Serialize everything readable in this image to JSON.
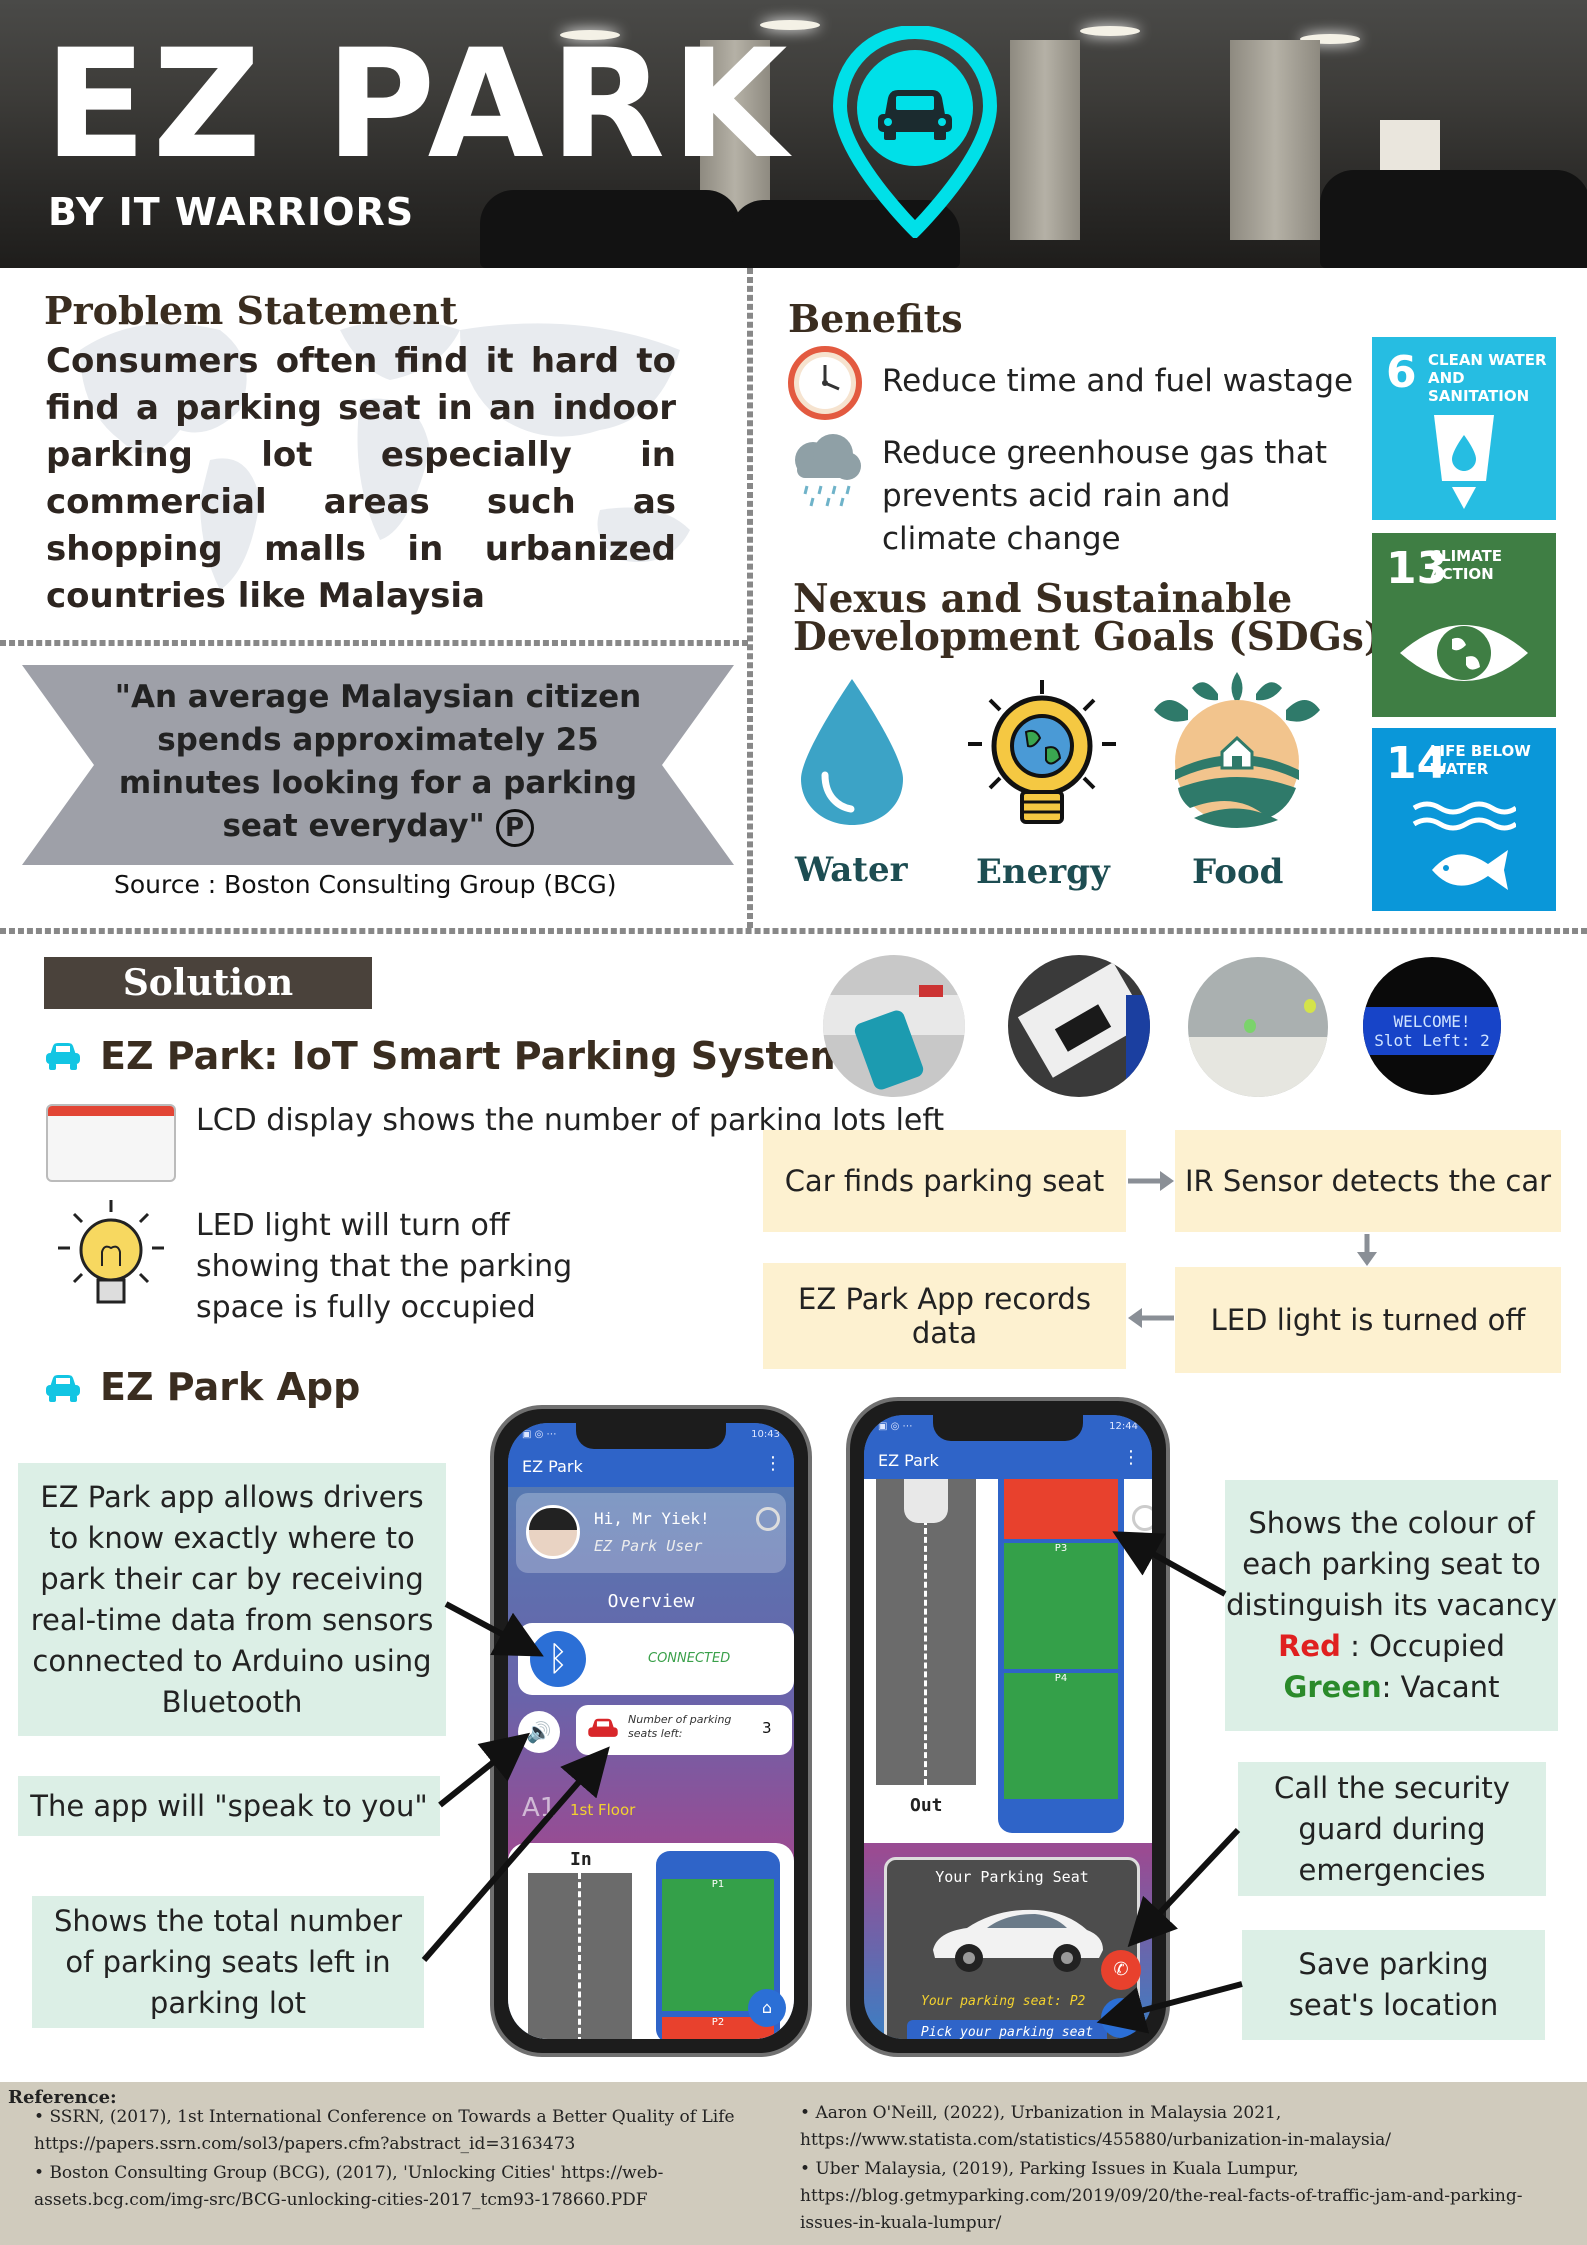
{
  "header": {
    "title": "EZ PARK",
    "subtitle": "BY IT WARRIORS",
    "pin_icon": "car-location-pin-icon",
    "accent": "#00e0e8"
  },
  "problem": {
    "heading": "Problem Statement",
    "text": "Consumers often find it hard to find a parking seat in an indoor parking lot especially in commercial areas such as shopping malls in urbanized countries like Malaysia"
  },
  "quote": {
    "text": "\"An average Malaysian citizen spends approximately 25 minutes looking for a parking seat everyday\"",
    "p_symbol": "P",
    "source": "Source : Boston Consulting Group (BCG)"
  },
  "benefits": {
    "heading": "Benefits",
    "items": [
      {
        "icon": "clock-icon",
        "text": "Reduce time and fuel wastage"
      },
      {
        "icon": "rain-cloud-icon",
        "text": "Reduce greenhouse gas that prevents acid rain and climate change"
      }
    ]
  },
  "nexus": {
    "heading_line1": "Nexus and Sustainable",
    "heading_line2": "Development Goals (SDGs)",
    "items": [
      {
        "icon": "water-drop-icon",
        "label": "Water"
      },
      {
        "icon": "lightbulb-globe-icon",
        "label": "Energy"
      },
      {
        "icon": "farm-icon",
        "label": "Food"
      }
    ]
  },
  "sdgs": [
    {
      "number": "6",
      "label": "CLEAN WATER AND SANITATION",
      "color": "#26bde2",
      "icon": "water-glass-icon"
    },
    {
      "number": "13",
      "label": "CLIMATE ACTION",
      "color": "#3f7e44",
      "icon": "earth-eye-icon"
    },
    {
      "number": "14",
      "label": "LIFE BELOW WATER",
      "color": "#0a97d9",
      "icon": "fish-waves-icon"
    }
  ],
  "solution": {
    "tag": "Solution",
    "system_title": "EZ Park: IoT Smart Parking System",
    "features": [
      {
        "icon": "lcd-window-icon",
        "text": "LCD display shows the number of parking lots left"
      },
      {
        "icon": "led-bulb-icon",
        "text": "LED light will turn off showing that the parking space is fully occupied"
      }
    ],
    "app_title": "EZ Park App",
    "lcd_line1": "WELCOME!",
    "lcd_line2": "Slot Left: 2"
  },
  "flow": {
    "steps": [
      "Car finds parking seat",
      "IR Sensor detects the car",
      "LED light is turned off",
      "EZ Park App records data"
    ]
  },
  "annotations": {
    "left": [
      "EZ Park app allows drivers to know exactly where to park their car by receiving real-time data from sensors connected to Arduino using Bluetooth",
      "The app will \"speak to you\"",
      "Shows the total number of parking seats left in parking lot"
    ],
    "right_vacancy_intro": "Shows the colour of each parking seat to distinguish its vacancy",
    "right_red": "Red",
    "right_red_meaning": " : Occupied",
    "right_green": "Green",
    "right_green_meaning": ": Vacant",
    "right_security": "Call the security guard during emergencies",
    "right_save": "Save parking seat's location",
    "red_color": "#e02020",
    "green_color": "#2a8a2a"
  },
  "phone1": {
    "time": "10:43",
    "app_name": "EZ Park",
    "greeting": "Hi, Mr Yiek!",
    "role": "EZ Park User",
    "overview": "Overview",
    "status": "CONNECTED",
    "seats_label": "Number of parking seats left:",
    "seats_value": "3",
    "floor": "1st Floor",
    "floor_code": "A1",
    "lane": "In",
    "slot1": "P1",
    "slot2": "P2"
  },
  "phone2": {
    "time": "12:44",
    "app_name": "EZ Park",
    "slot3": "P3",
    "slot4": "P4",
    "lane": "Out",
    "card_title": "Your Parking Seat",
    "card_seat": "Your parking seat: P2",
    "card_button": "Pick your parking seat"
  },
  "references": {
    "heading": "Reference:",
    "left": [
      "SSRN, (2017), 1st International Conference on Towards a Better Quality of Life https://papers.ssrn.com/sol3/papers.cfm?abstract_id=3163473",
      "Boston Consulting Group (BCG), (2017), 'Unlocking Cities' https://web-assets.bcg.com/img-src/BCG-unlocking-cities-2017_tcm93-178660.PDF"
    ],
    "right": [
      "Aaron O'Neill, (2022), Urbanization in Malaysia 2021, https://www.statista.com/statistics/455880/urbanization-in-malaysia/",
      "Uber Malaysia, (2019), Parking Issues in Kuala Lumpur, https://blog.getmyparking.com/2019/09/20/the-real-facts-of-traffic-jam-and-parking-issues-in-kuala-lumpur/"
    ]
  }
}
